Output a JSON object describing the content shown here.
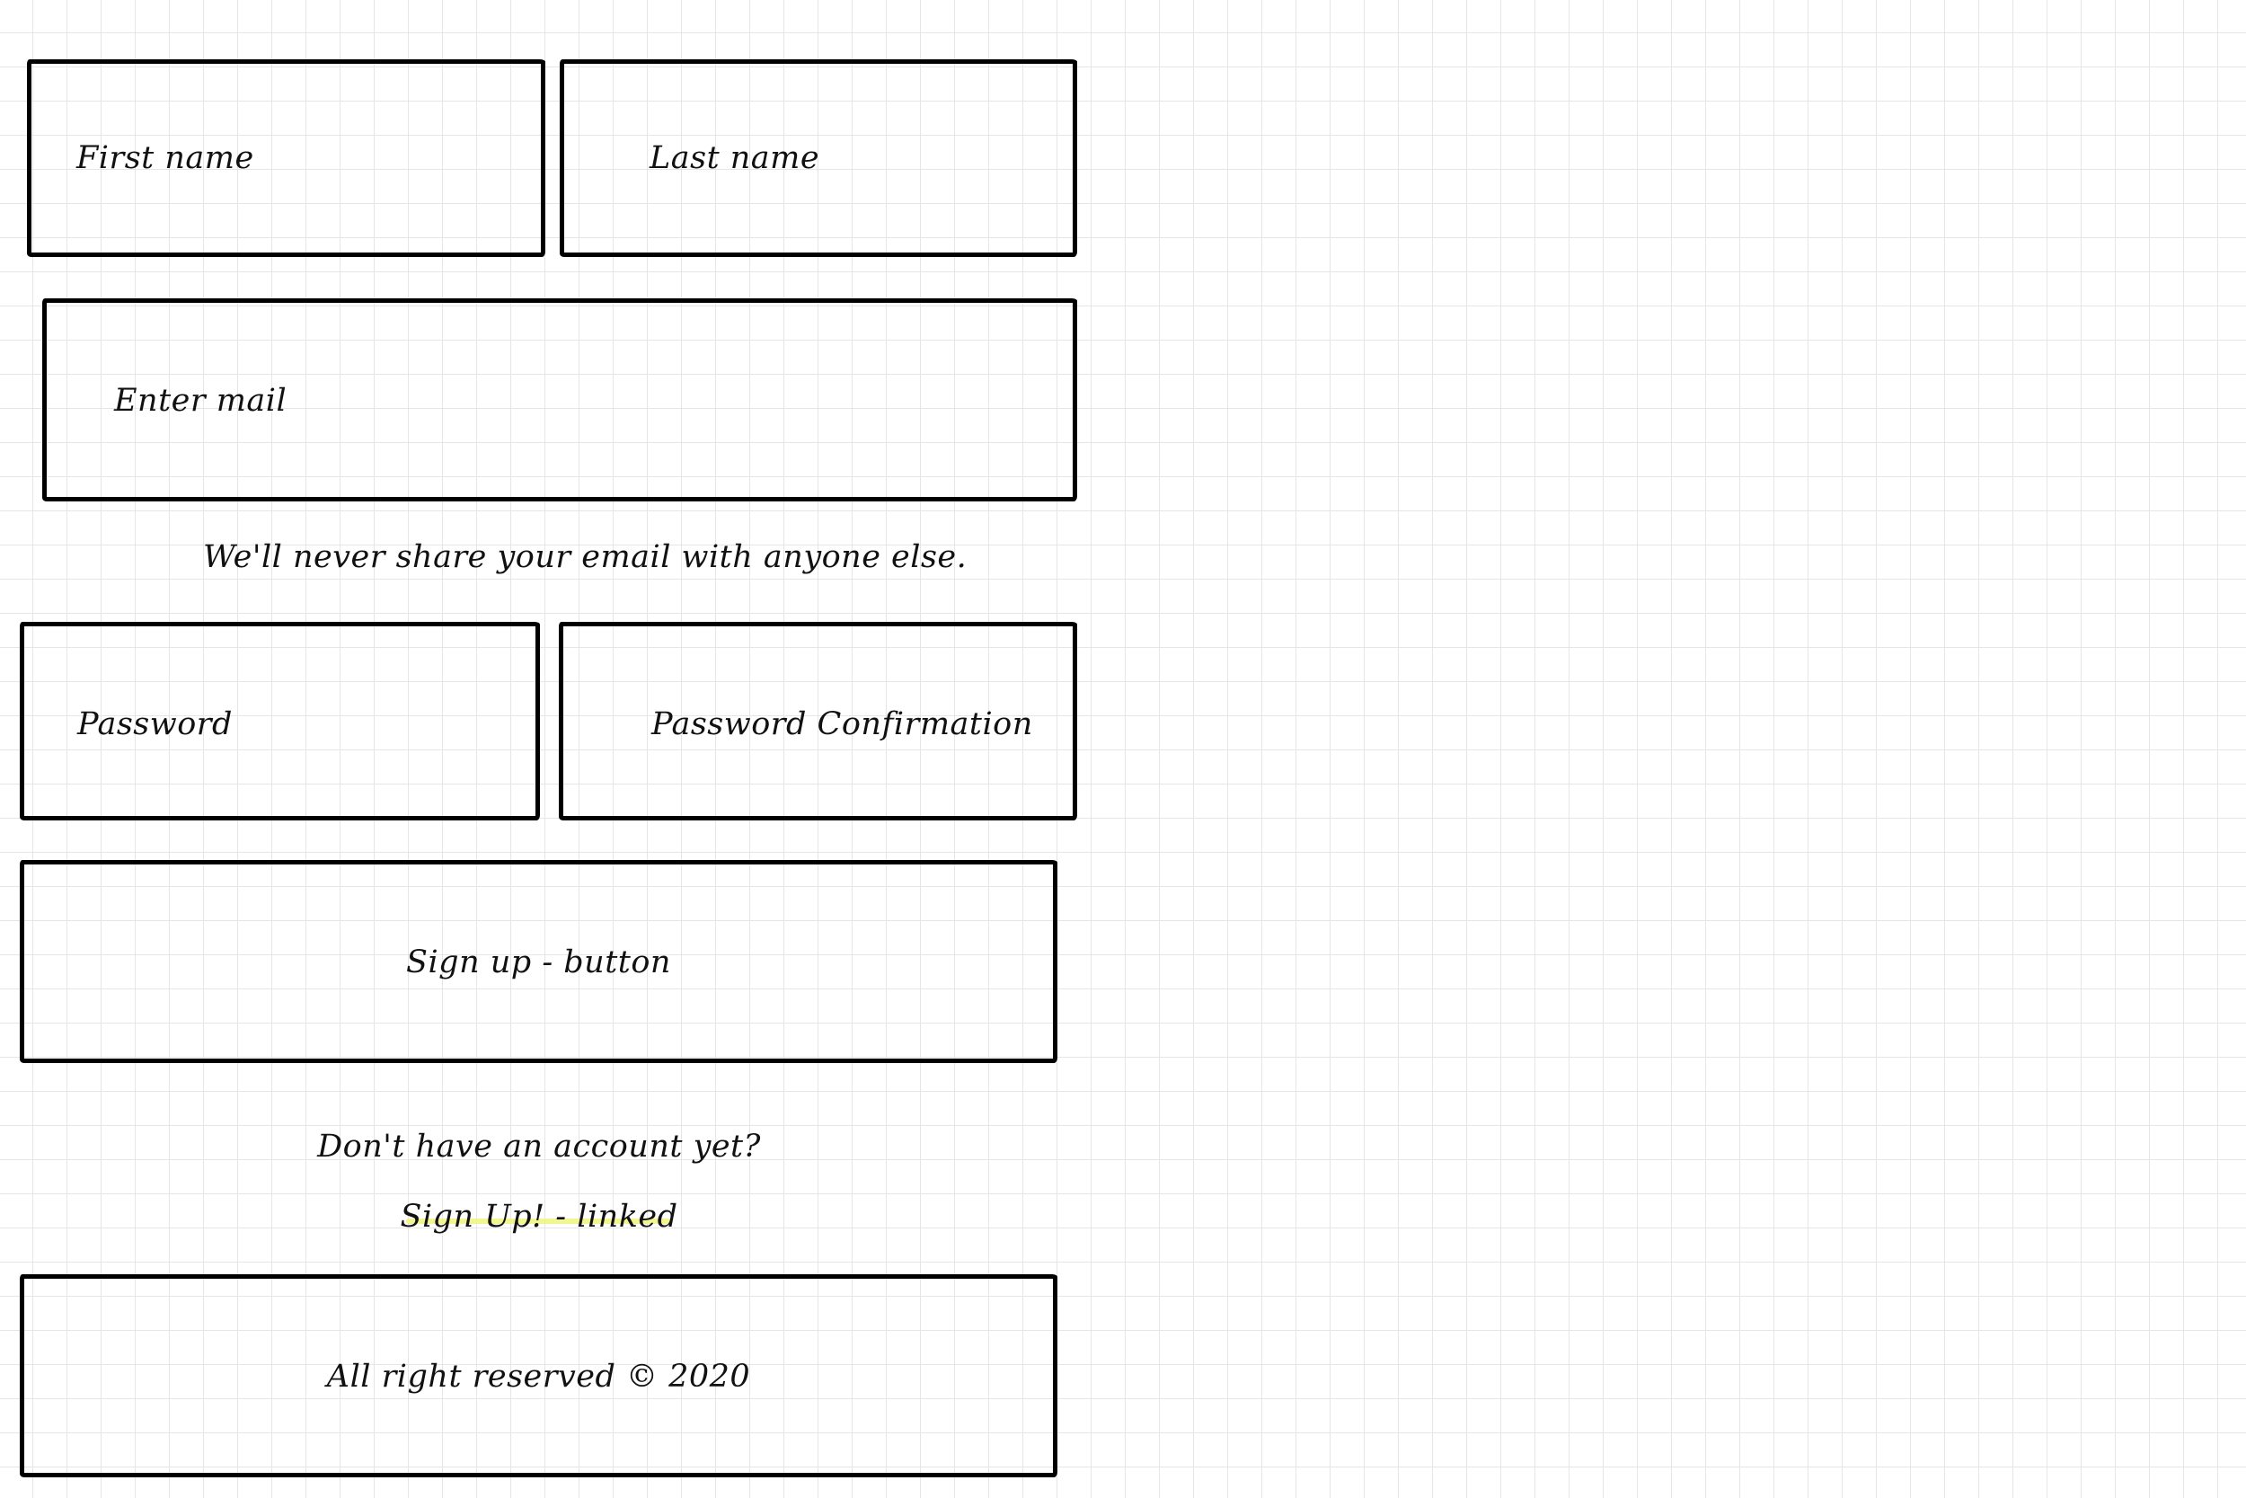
{
  "form": {
    "first_name_placeholder": "First name",
    "last_name_placeholder": "Last name",
    "email_placeholder": "Enter mail",
    "email_help": "We'll never share your email with anyone else.",
    "password_placeholder": "Password",
    "password_confirmation_placeholder": "Password Confirmation",
    "submit_label": "Sign up - button"
  },
  "account_prompt": {
    "question": "Don't have an account yet?",
    "link_label": "Sign Up! - linked"
  },
  "footer": {
    "text": "All right reserved © 2020"
  },
  "colors": {
    "grid_line": "#e6e6e6",
    "border": "#000000",
    "link_highlight": "#eef57a"
  }
}
